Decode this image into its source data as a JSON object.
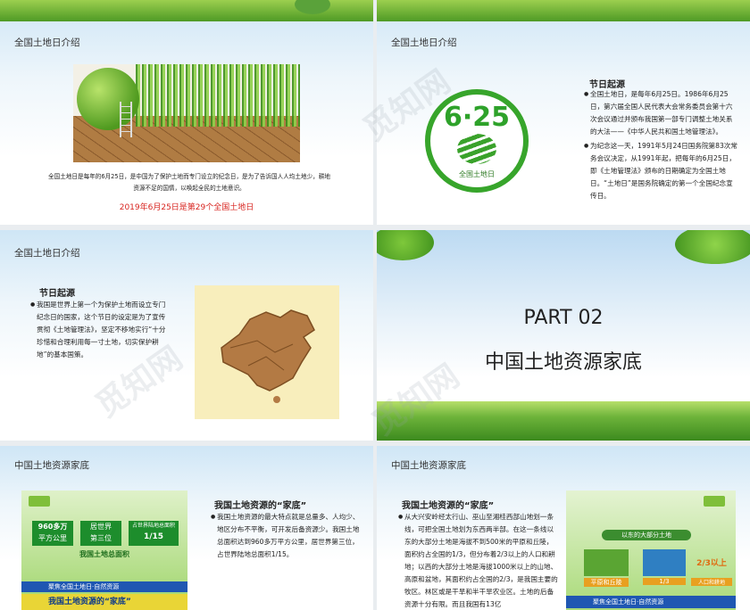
{
  "slide1": {
    "title": "全国土地日介绍",
    "paragraph": "全国土地日是每年的6月25日，是中国为了保护土地而专门设立的纪念日，是为了告诉国人人均土地少，耕地资源不足的国情，以唤起全民的土地意识。",
    "highlight": "2019年6月25日是第29个全国土地日"
  },
  "slide2": {
    "title": "全国土地日介绍",
    "logo_number": "6·25",
    "logo_text": "全国土地日",
    "heading": "节日起源",
    "bullets": [
      "全国土地日，是每年6月25日。1986年6月25日，第六届全国人民代表大会常务委员会第十六次会议通过并颁布我国第一部专门调整土地关系的大法——《中华人民共和国土地管理法》。",
      "为纪念这一天，1991年5月24日国务院第83次常务会议决定，从1991年起，把每年的6月25日，即《土地管理法》颁布的日期确定为全国土地日。“土地日”是国务院确定的第一个全国纪念宣传日。"
    ]
  },
  "slide3": {
    "title": "全国土地日介绍",
    "heading": "节日起源",
    "bullets": [
      "我国是世界上第一个为保护土地而设立专门纪念日的国家，这个节日的设定是为了宣传贯彻《土地管理法》，坚定不移地实行“十分珍惜和合理利用每一寸土地，切实保护耕地”的基本国策。"
    ]
  },
  "slide4": {
    "part": "PART 02",
    "title": "中国土地资源家底"
  },
  "slide5": {
    "title": "中国土地资源家底",
    "heading": "我国土地资源的“家底”",
    "bullets": [
      "我国土地资源的最大特点就是总量多、人均少、地区分布不平衡，可开发后备资源少。我国土地总面积达到960多万平方公里，居世界第三位，占世界陆地总面积1/15。"
    ],
    "img": {
      "stat1": "960多万",
      "stat1b": "平方公里",
      "stat2": "居世界",
      "stat2b": "第三位",
      "stat3": "占世界陆地总面积",
      "stat3b": "1/15",
      "caption": "我国土地总面积",
      "ticker": "聚焦全国土地日·自然资源",
      "banner": "我国土地资源的“家底”"
    }
  },
  "slide6": {
    "title": "中国土地资源家底",
    "heading": "我国土地资源的“家底”",
    "bullets": [
      "从大兴安岭经太行山、巫山至湘桂西部山地划一条线，可把全国土地划为东西两半部。在这一条线以东的大部分土地是海拔不到500米的平原和丘陵，面积约占全国的1/3，但分布着2/3以上的人口和耕地；以西的大部分土地是海拔1000米以上的山地、高原和盆地，其面积约占全国的2/3，是我国主要的牧区。林区或是干旱和半干旱农业区。土地的后备资源十分有限。而且我国有13亿"
    ],
    "img": {
      "caption": "以东的大部分土地",
      "c1": "平原和丘陵",
      "c2": "1/3",
      "c3": "2/3以上",
      "c3b": "人口和耕地",
      "ticker": "聚焦全国土地日·自然资源"
    }
  },
  "watermark": "觅知网"
}
